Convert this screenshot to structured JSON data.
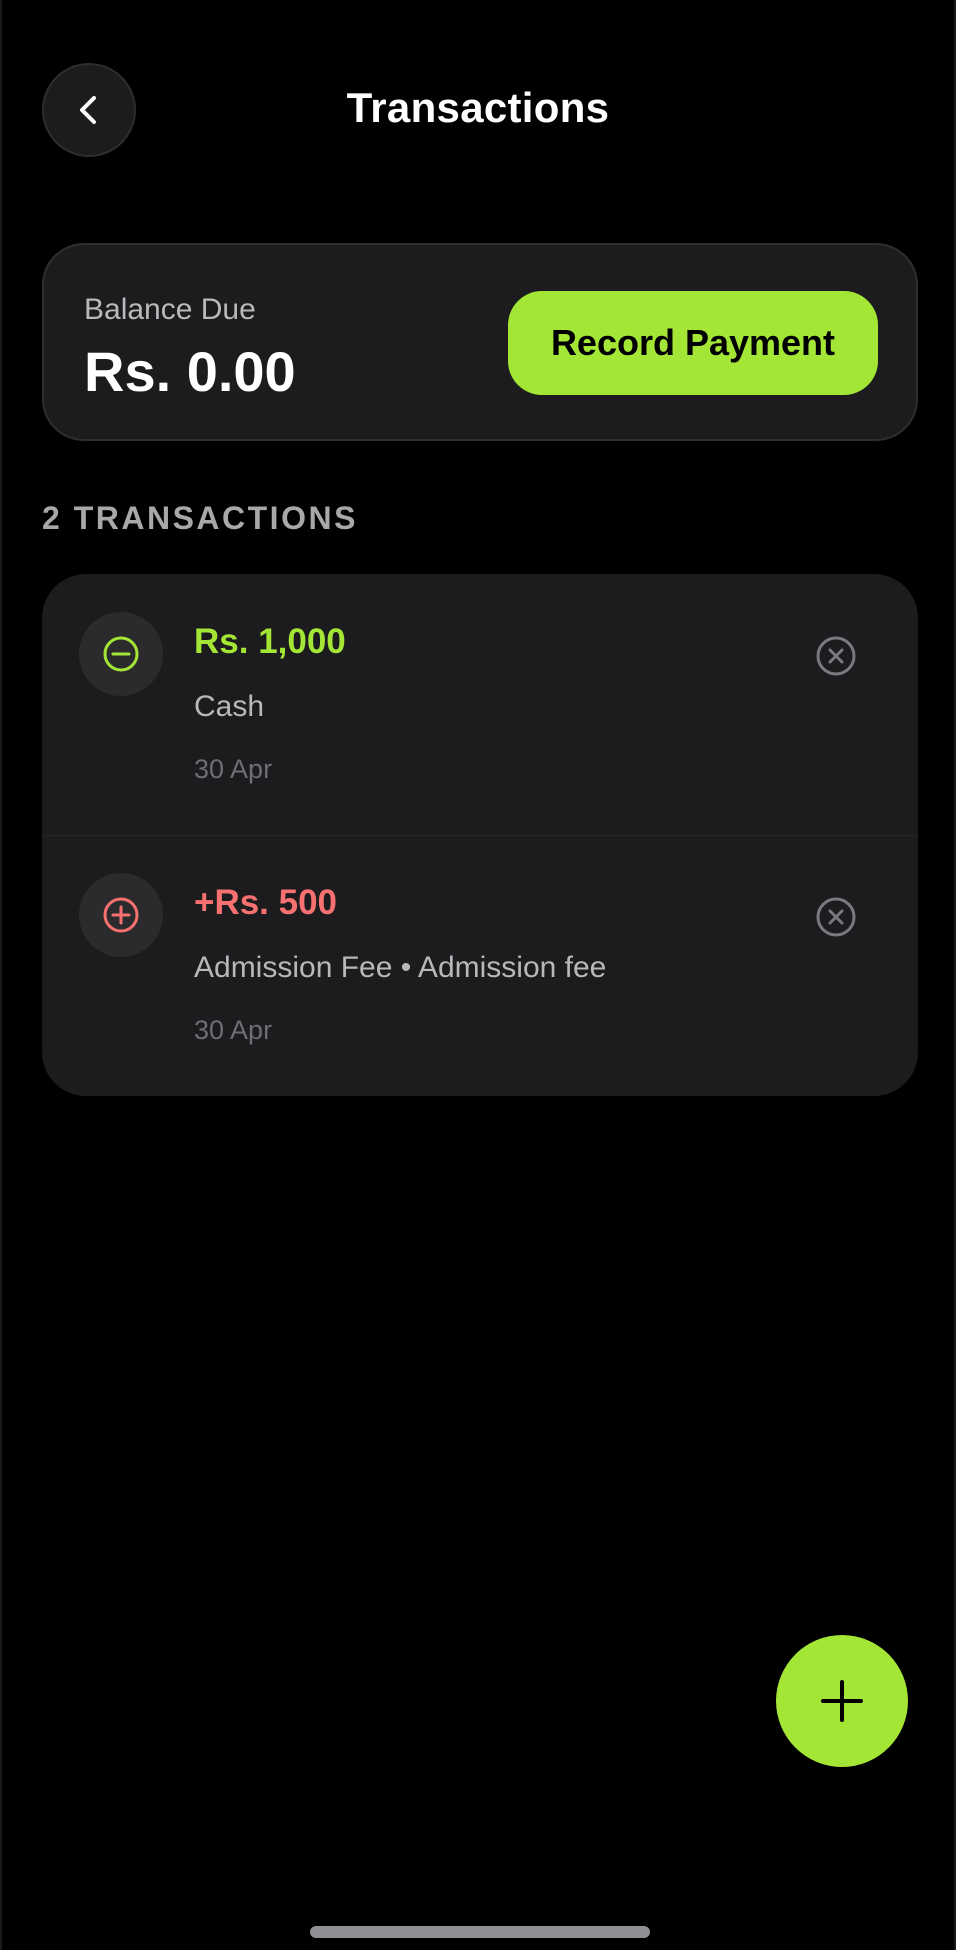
{
  "header": {
    "title": "Transactions",
    "back_icon": "chevron-left-icon"
  },
  "balance": {
    "label": "Balance Due",
    "amount": "Rs. 0.00",
    "record_payment_label": "Record Payment"
  },
  "transactions_heading": "2 TRANSACTIONS",
  "transactions": [
    {
      "amount": "Rs. 1,000",
      "amount_color": "#a3e635",
      "icon": "minus-circle-icon",
      "description": "Cash",
      "date": "30 Apr",
      "delete_icon": "close-circle-icon"
    },
    {
      "amount": "+Rs. 500",
      "amount_color": "#f87171",
      "icon": "plus-circle-icon",
      "description": "Admission Fee • Admission fee",
      "date": "30 Apr",
      "delete_icon": "close-circle-icon"
    }
  ],
  "fab": {
    "icon": "plus-icon"
  },
  "colors": {
    "accent": "#a3e635",
    "debit": "#f87171",
    "card": "#1c1c1e",
    "background": "#000000"
  }
}
